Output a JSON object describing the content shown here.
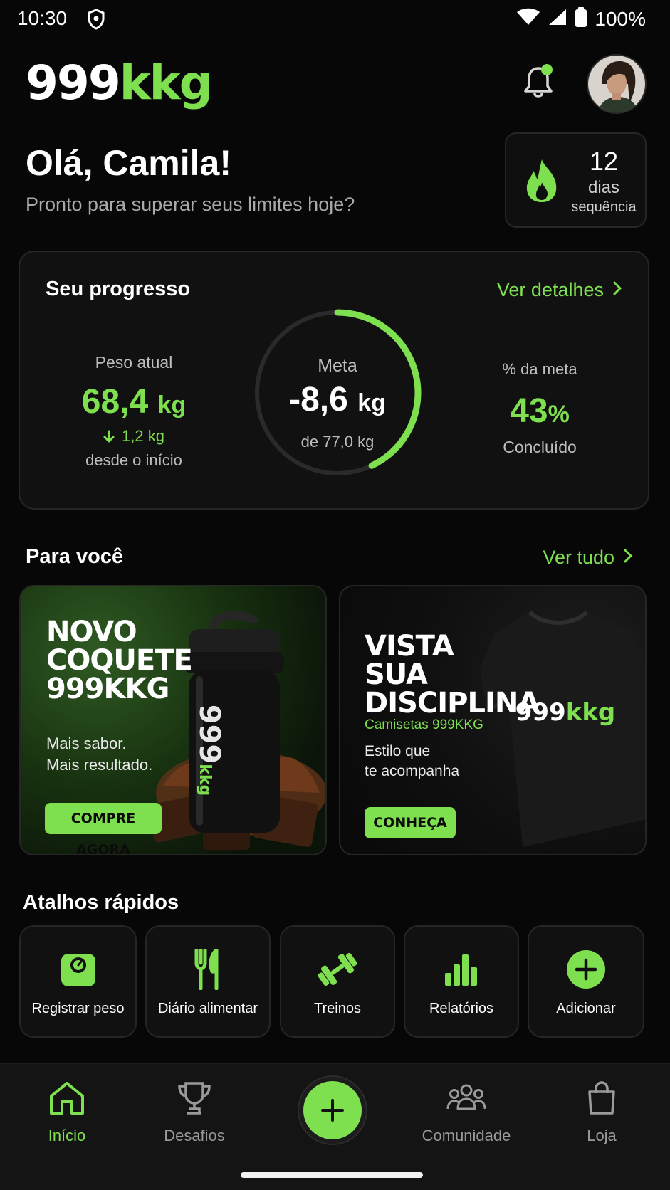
{
  "status_bar": {
    "time": "10:30",
    "battery": "100%"
  },
  "header": {
    "logo_white": "999",
    "logo_green": "kkg"
  },
  "greeting": {
    "title": "Olá, Camila!",
    "subtitle": "Pronto para superar seus limites hoje?"
  },
  "streak": {
    "count": "12",
    "unit": "dias",
    "label": "sequência"
  },
  "progress": {
    "title": "Seu progresso",
    "link": "Ver detalhes",
    "current_label": "Peso atual",
    "current_value": "68,4",
    "current_unit": "kg",
    "delta": "1,2 kg",
    "since": "desde o início",
    "goal_label": "Meta",
    "goal_value": "-8,6",
    "goal_unit": "kg",
    "goal_sub": "de 77,0 kg",
    "pct_label": "% da meta",
    "pct_value": "43",
    "pct_unit": "%",
    "pct_sub": "Concluído",
    "ring_fraction": 0.43,
    "accent": "#7ee04f"
  },
  "for_you": {
    "title": "Para você",
    "link": "Ver tudo",
    "cards": [
      {
        "heading_lines": [
          "NOVO",
          "COQUETE",
          "999KKG"
        ],
        "sub_lines": [
          "Mais sabor.",
          "Mais resultado."
        ],
        "button": "COMPRE AGORA",
        "product_logo_white": "999",
        "product_logo_green": "kkg"
      },
      {
        "heading_lines": [
          "VISTA SUA",
          "DISCIPLINA"
        ],
        "tag": "Camisetas 999KKG",
        "sub_lines": [
          "Estilo que",
          "te acompanha"
        ],
        "button": "CONHEÇA",
        "product_logo_white": "999",
        "product_logo_green": "kkg"
      }
    ]
  },
  "shortcuts": {
    "title": "Atalhos rápidos",
    "items": [
      {
        "label": "Registrar peso",
        "icon": "scale-icon"
      },
      {
        "label": "Diário alimentar",
        "icon": "fork-knife-icon"
      },
      {
        "label": "Treinos",
        "icon": "dumbbell-icon"
      },
      {
        "label": "Relatórios",
        "icon": "bar-chart-icon"
      },
      {
        "label": "Adicionar",
        "icon": "plus-circle-icon"
      }
    ]
  },
  "bottom_nav": {
    "items": [
      {
        "label": "Início",
        "icon": "home-icon",
        "active": true
      },
      {
        "label": "Desafios",
        "icon": "trophy-icon",
        "active": false
      },
      {
        "label": "Comunidade",
        "icon": "community-icon",
        "active": false
      },
      {
        "label": "Loja",
        "icon": "shopping-bag-icon",
        "active": false
      }
    ]
  }
}
